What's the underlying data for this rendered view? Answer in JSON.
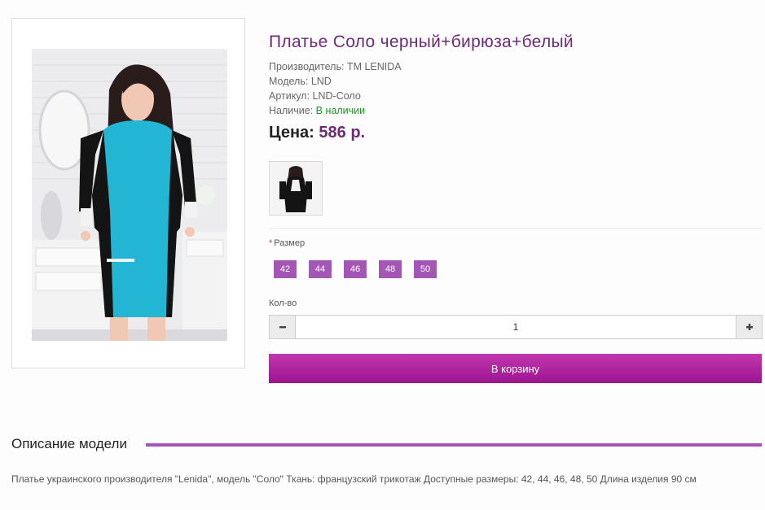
{
  "product": {
    "title": "Платье Соло черный+бирюза+белый",
    "manufacturer": "Производитель: TM LENIDA",
    "model": "Модель: LND",
    "sku": "Артикул: LND-Соло",
    "availability_label": "Наличие: ",
    "availability_value": "В наличии",
    "price_label": "Цена: ",
    "price_value": "586 р."
  },
  "options": {
    "required_mark": "*",
    "size_label": "Размер",
    "sizes": [
      "42",
      "44",
      "46",
      "48",
      "50"
    ],
    "quantity_label": "Кол-во",
    "quantity_value": "1",
    "minus_icon": "minus-icon",
    "plus_icon": "plus-icon"
  },
  "cart_button": "В корзину",
  "description": {
    "heading": "Описание модели",
    "text": "Платье украинского производителя \"Lenida\", модель \"Соло\" Ткань: французский трикотаж Доступные размеры: 42, 44, 46, 48, 50 Длина изделия 90 см"
  },
  "colors": {
    "accent": "#a356b4",
    "title": "#6e2a78",
    "stock": "#1a9a1a",
    "cart_top": "#c038ad",
    "cart_bottom": "#9d1491"
  }
}
